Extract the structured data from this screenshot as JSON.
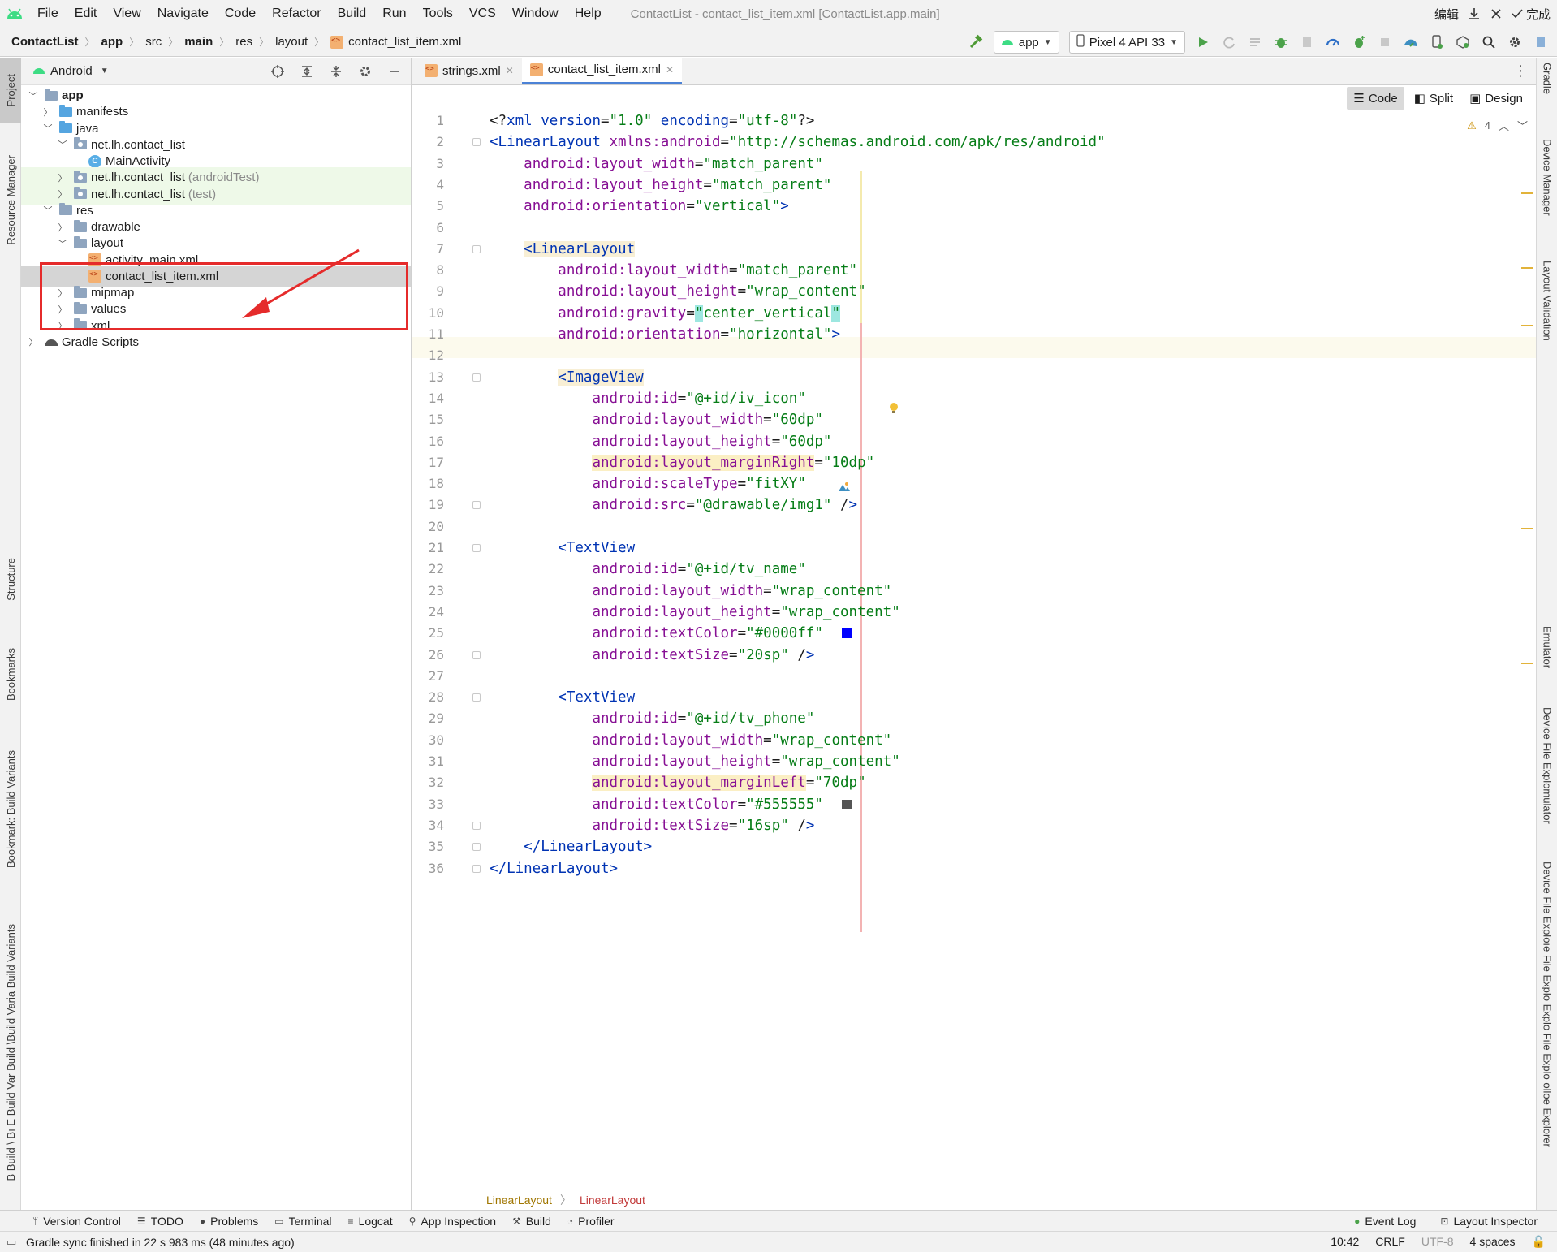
{
  "menubar": {
    "items": [
      "File",
      "Edit",
      "View",
      "Navigate",
      "Code",
      "Refactor",
      "Build",
      "Run",
      "Tools",
      "VCS",
      "Window",
      "Help"
    ],
    "title": "ContactList - contact_list_item.xml [ContactList.app.main]",
    "edit_label": "编辑",
    "done_label": "完成"
  },
  "breadcrumb": [
    "ContactList",
    "app",
    "src",
    "main",
    "res",
    "layout",
    "contact_list_item.xml"
  ],
  "run_config": {
    "module": "app",
    "device": "Pixel 4 API 33"
  },
  "left_tabs": [
    "Project",
    "Resource Manager",
    "Structure",
    "Bookmarks",
    "Bookmark: Build Variants",
    "B Build \\ Bı E Build Var Build \\Build Varia Build Variants"
  ],
  "right_tabs": [
    "Gradle",
    "Device Manager",
    "Layout Validation",
    "Emulator",
    "Device File Explomulator",
    "Device File Exploıe File Explo Explo File Explo olloe Explorer"
  ],
  "project": {
    "view": "Android",
    "tree": [
      {
        "label": "app",
        "suffix": "",
        "icon": "folder-gray",
        "depth": 0,
        "expanded": true,
        "bold": true
      },
      {
        "label": "manifests",
        "suffix": "",
        "icon": "folder-blue",
        "depth": 1,
        "expanded": false
      },
      {
        "label": "java",
        "suffix": "",
        "icon": "folder-blue",
        "depth": 1,
        "expanded": true
      },
      {
        "label": "net.lh.contact_list",
        "suffix": "",
        "icon": "package",
        "depth": 2,
        "expanded": true
      },
      {
        "label": "MainActivity",
        "suffix": "",
        "icon": "class",
        "depth": 3,
        "expanded": null
      },
      {
        "label": "net.lh.contact_list",
        "suffix": "(androidTest)",
        "icon": "package",
        "depth": 2,
        "expanded": false,
        "tinted": true
      },
      {
        "label": "net.lh.contact_list",
        "suffix": "(test)",
        "icon": "package",
        "depth": 2,
        "expanded": false,
        "tinted": true
      },
      {
        "label": "res",
        "suffix": "",
        "icon": "folder-gray",
        "depth": 1,
        "expanded": true
      },
      {
        "label": "drawable",
        "suffix": "",
        "icon": "folder-gray",
        "depth": 2,
        "expanded": false
      },
      {
        "label": "layout",
        "suffix": "",
        "icon": "folder-gray",
        "depth": 2,
        "expanded": true
      },
      {
        "label": "activity_main.xml",
        "suffix": "",
        "icon": "xml",
        "depth": 3,
        "expanded": null
      },
      {
        "label": "contact_list_item.xml",
        "suffix": "",
        "icon": "xml",
        "depth": 3,
        "expanded": null,
        "selected": true
      },
      {
        "label": "mipmap",
        "suffix": "",
        "icon": "folder-gray",
        "depth": 2,
        "expanded": false
      },
      {
        "label": "values",
        "suffix": "",
        "icon": "folder-gray",
        "depth": 2,
        "expanded": false
      },
      {
        "label": "xml",
        "suffix": "",
        "icon": "folder-gray",
        "depth": 2,
        "expanded": false
      },
      {
        "label": "Gradle Scripts",
        "suffix": "",
        "icon": "gradle",
        "depth": 0,
        "expanded": false
      }
    ]
  },
  "editor": {
    "tabs": [
      {
        "label": "strings.xml",
        "active": false
      },
      {
        "label": "contact_list_item.xml",
        "active": true
      }
    ],
    "view_modes": [
      "Code",
      "Split",
      "Design"
    ],
    "warning_count": "4",
    "lines": [
      "<?xml version=\"1.0\" encoding=\"utf-8\"?>",
      "<LinearLayout xmlns:android=\"http://schemas.android.com/apk/res/android\"",
      "    android:layout_width=\"match_parent\"",
      "    android:layout_height=\"match_parent\"",
      "    android:orientation=\"vertical\">",
      "",
      "    <LinearLayout",
      "        android:layout_width=\"match_parent\"",
      "        android:layout_height=\"wrap_content\"",
      "        android:gravity=\"center_vertical\"",
      "        android:orientation=\"horizontal\">",
      "",
      "        <ImageView",
      "            android:id=\"@+id/iv_icon\"",
      "            android:layout_width=\"60dp\"",
      "            android:layout_height=\"60dp\"",
      "            android:layout_marginRight=\"10dp\"",
      "            android:scaleType=\"fitXY\"",
      "            android:src=\"@drawable/img1\" />",
      "",
      "        <TextView",
      "            android:id=\"@+id/tv_name\"",
      "            android:layout_width=\"wrap_content\"",
      "            android:layout_height=\"wrap_content\"",
      "            android:textColor=\"#0000ff\"",
      "            android:textSize=\"20sp\" />",
      "",
      "        <TextView",
      "            android:id=\"@+id/tv_phone\"",
      "            android:layout_width=\"wrap_content\"",
      "            android:layout_height=\"wrap_content\"",
      "            android:layout_marginLeft=\"70dp\"",
      "            android:textColor=\"#555555\"",
      "            android:textSize=\"16sp\" />",
      "    </LinearLayout>",
      "</LinearLayout>"
    ],
    "color_swatches": [
      {
        "line": 25,
        "color": "#0000ff"
      },
      {
        "line": 33,
        "color": "#555555"
      }
    ],
    "breadcrumb": [
      "LinearLayout",
      "LinearLayout"
    ]
  },
  "bottom_tabs": [
    "Version Control",
    "TODO",
    "Problems",
    "Terminal",
    "Logcat",
    "App Inspection",
    "Build",
    "Profiler"
  ],
  "bottom_tabs_right": [
    "Event Log",
    "Layout Inspector"
  ],
  "status": {
    "message": "Gradle sync finished in 22 s 983 ms (48 minutes ago)",
    "position": "10:42",
    "line_sep": "CRLF",
    "encoding": "UTF-8",
    "indent": "4 spaces"
  },
  "colors": {
    "tag": "#0033b3",
    "attribute": "#871094",
    "value": "#067d17",
    "accent_tab": "#4c82d6",
    "annotation_box": "#e52b2b"
  }
}
